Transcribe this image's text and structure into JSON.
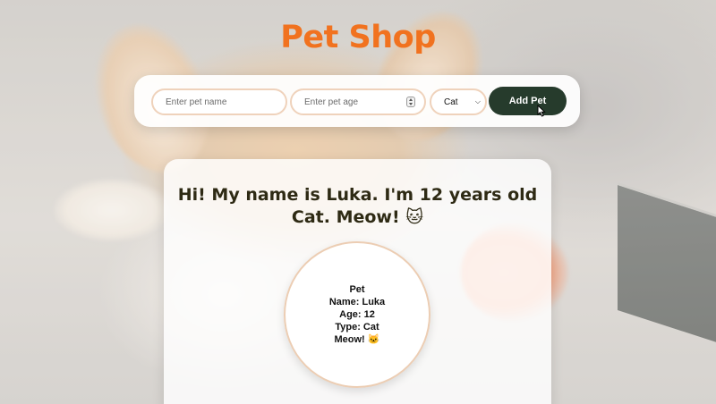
{
  "app": {
    "title": "Pet Shop"
  },
  "form": {
    "name_placeholder": "Enter pet name",
    "age_placeholder": "Enter pet age",
    "type_selected": "Cat",
    "add_button_label": "Add Pet"
  },
  "pet_card": {
    "greeting_line1": "Hi! My name is Luka. I'm 12 years old",
    "greeting_line2": "Cat. Meow! 🐱",
    "details": {
      "heading": "Pet",
      "name": "Name: Luka",
      "age": "Age: 12",
      "type": "Type: Cat",
      "sound": "Meow! 🐱"
    }
  },
  "colors": {
    "title": "#f1721f",
    "button": "#263b2c",
    "field_border": "#efd2bb",
    "greeting_text": "#2e2a14"
  },
  "icons": {
    "cursor": "pointer-cursor-icon",
    "select_chevron": "chevron-down-icon",
    "age_stepper": "number-stepper-icon"
  }
}
